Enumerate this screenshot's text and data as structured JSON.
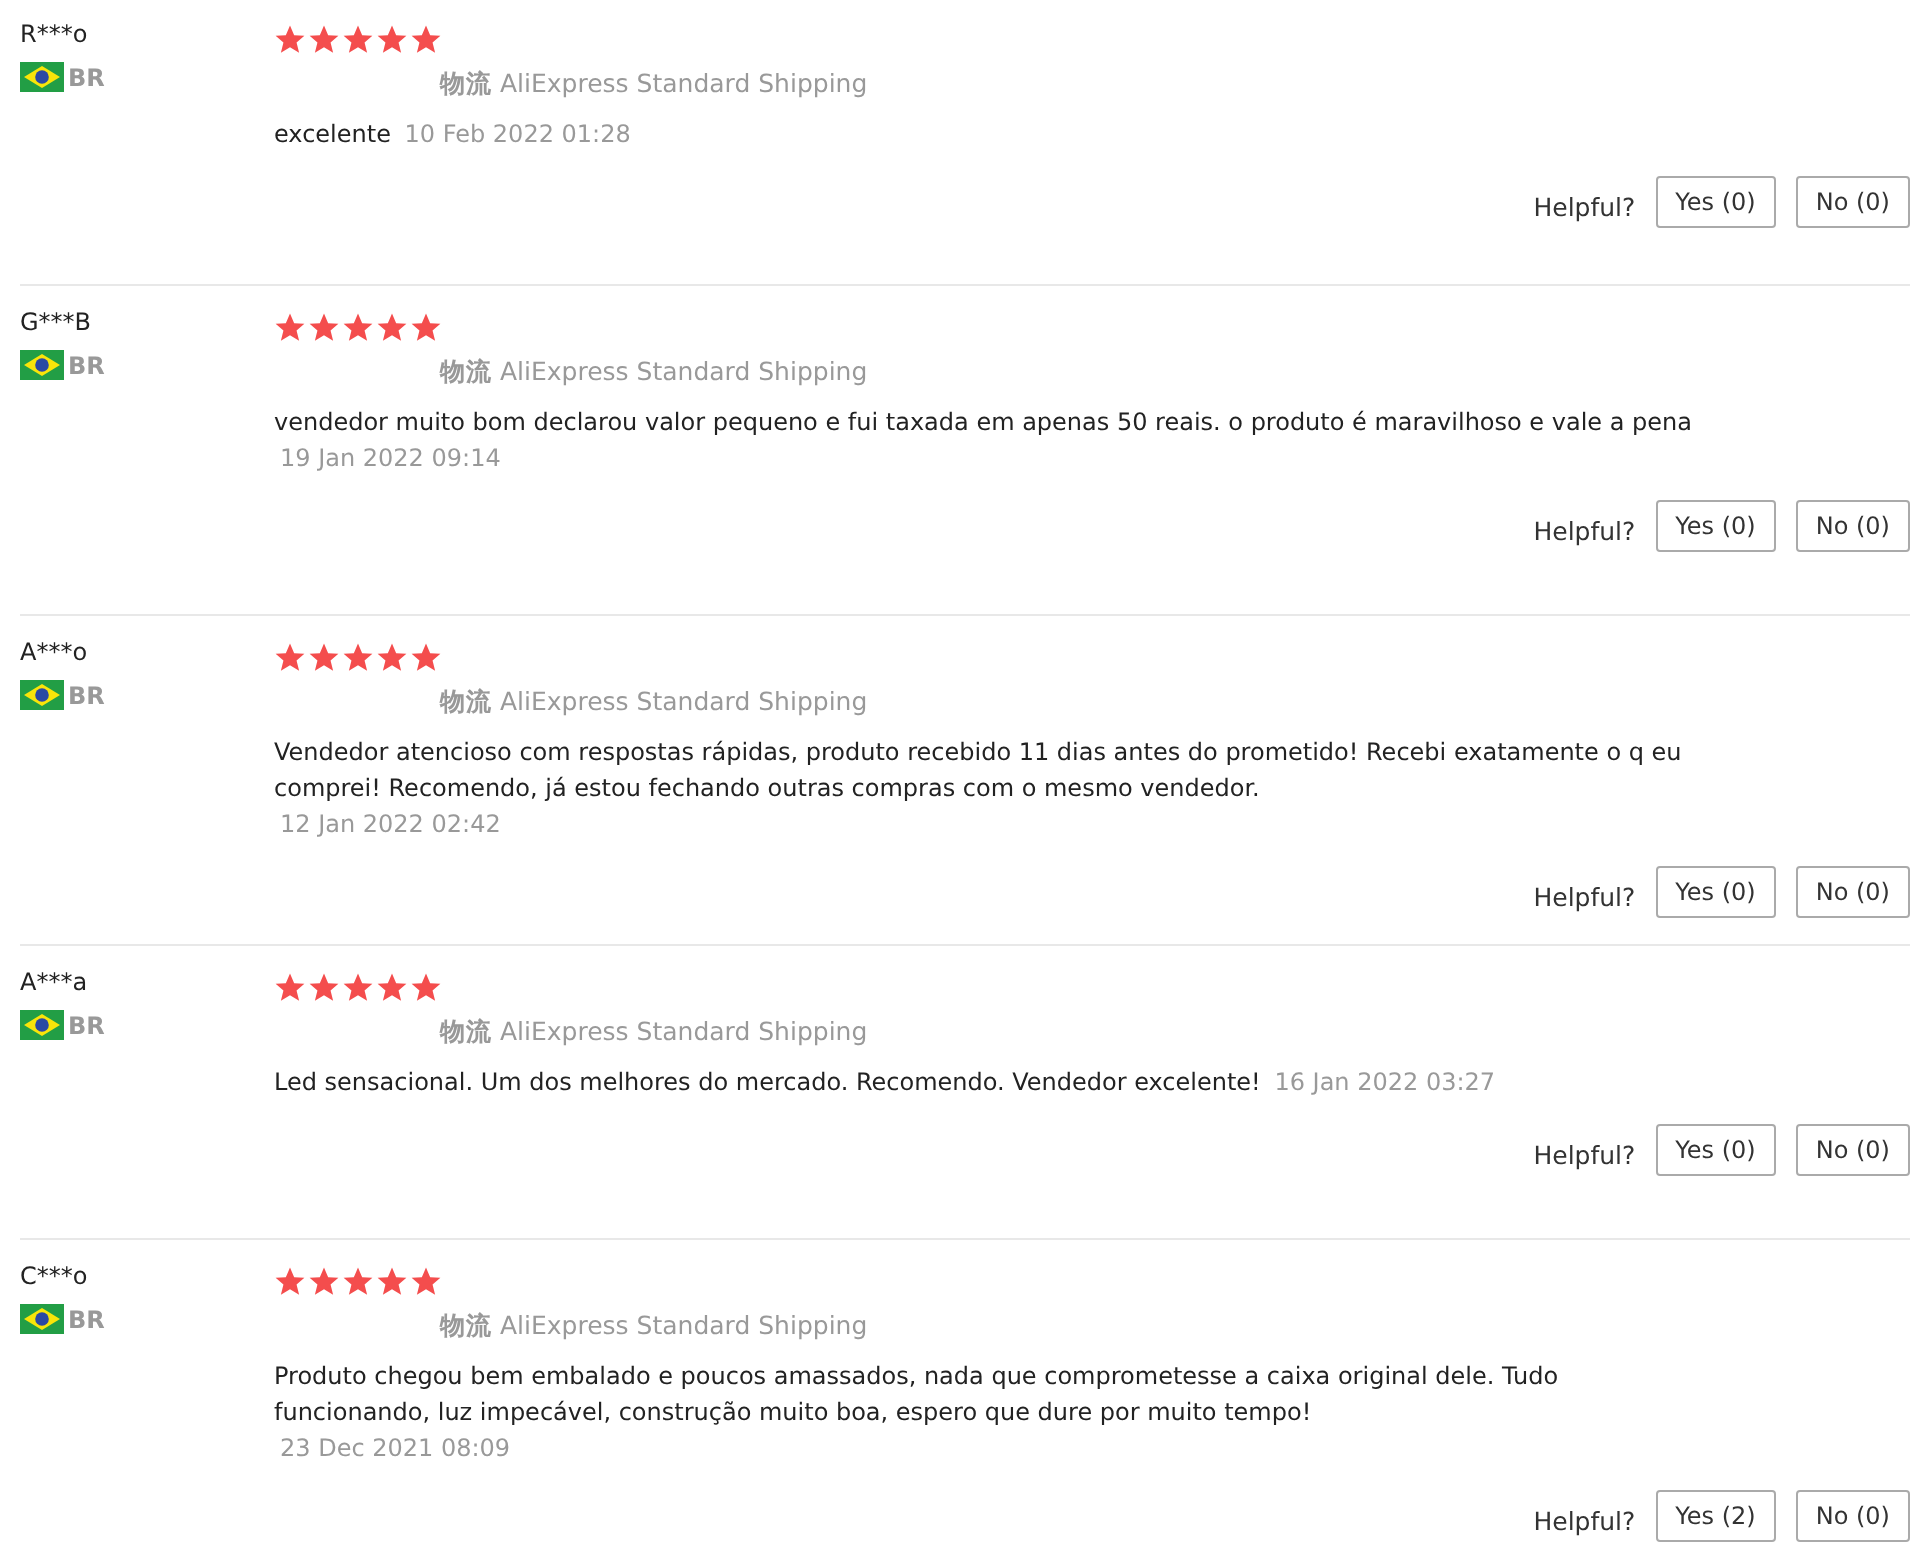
{
  "reviews": [
    {
      "user": "R***o",
      "country": "BR",
      "stars": 5,
      "logistics_label": "物流",
      "shipping": "AliExpress Standard Shipping",
      "text": "excelente",
      "date": "10 Feb 2022 01:28",
      "helpful_label": "Helpful?",
      "yes": "Yes (0)",
      "no": "No (0)"
    },
    {
      "user": "G***B",
      "country": "BR",
      "stars": 5,
      "logistics_label": "物流",
      "shipping": "AliExpress Standard Shipping",
      "text": "vendedor muito bom declarou valor pequeno e fui taxada em apenas 50 reais. o produto é maravilhoso e vale a pena",
      "date": "19 Jan 2022 09:14",
      "helpful_label": "Helpful?",
      "yes": "Yes (0)",
      "no": "No (0)"
    },
    {
      "user": "A***o",
      "country": "BR",
      "stars": 5,
      "logistics_label": "物流",
      "shipping": "AliExpress Standard Shipping",
      "text": "Vendedor atencioso com respostas rápidas, produto recebido 11 dias antes do prometido! Recebi exatamente o q eu comprei! Recomendo, já estou fechando outras compras com o mesmo vendedor.",
      "date": "12 Jan 2022 02:42",
      "helpful_label": "Helpful?",
      "yes": "Yes (0)",
      "no": "No (0)"
    },
    {
      "user": "A***a",
      "country": "BR",
      "stars": 5,
      "logistics_label": "物流",
      "shipping": "AliExpress Standard Shipping",
      "text": "Led sensacional. Um dos melhores do mercado. Recomendo. Vendedor excelente!",
      "date": "16 Jan 2022 03:27",
      "helpful_label": "Helpful?",
      "yes": "Yes (0)",
      "no": "No (0)"
    },
    {
      "user": "C***o",
      "country": "BR",
      "stars": 5,
      "logistics_label": "物流",
      "shipping": "AliExpress Standard Shipping",
      "text": "Produto chegou bem embalado e poucos amassados, nada que comprometesse a caixa original dele. Tudo funcionando, luz impecável, construção muito boa, espero que dure por muito tempo!",
      "date": "23 Dec 2021 08:09",
      "helpful_label": "Helpful?",
      "yes": "Yes (2)",
      "no": "No (0)"
    }
  ]
}
